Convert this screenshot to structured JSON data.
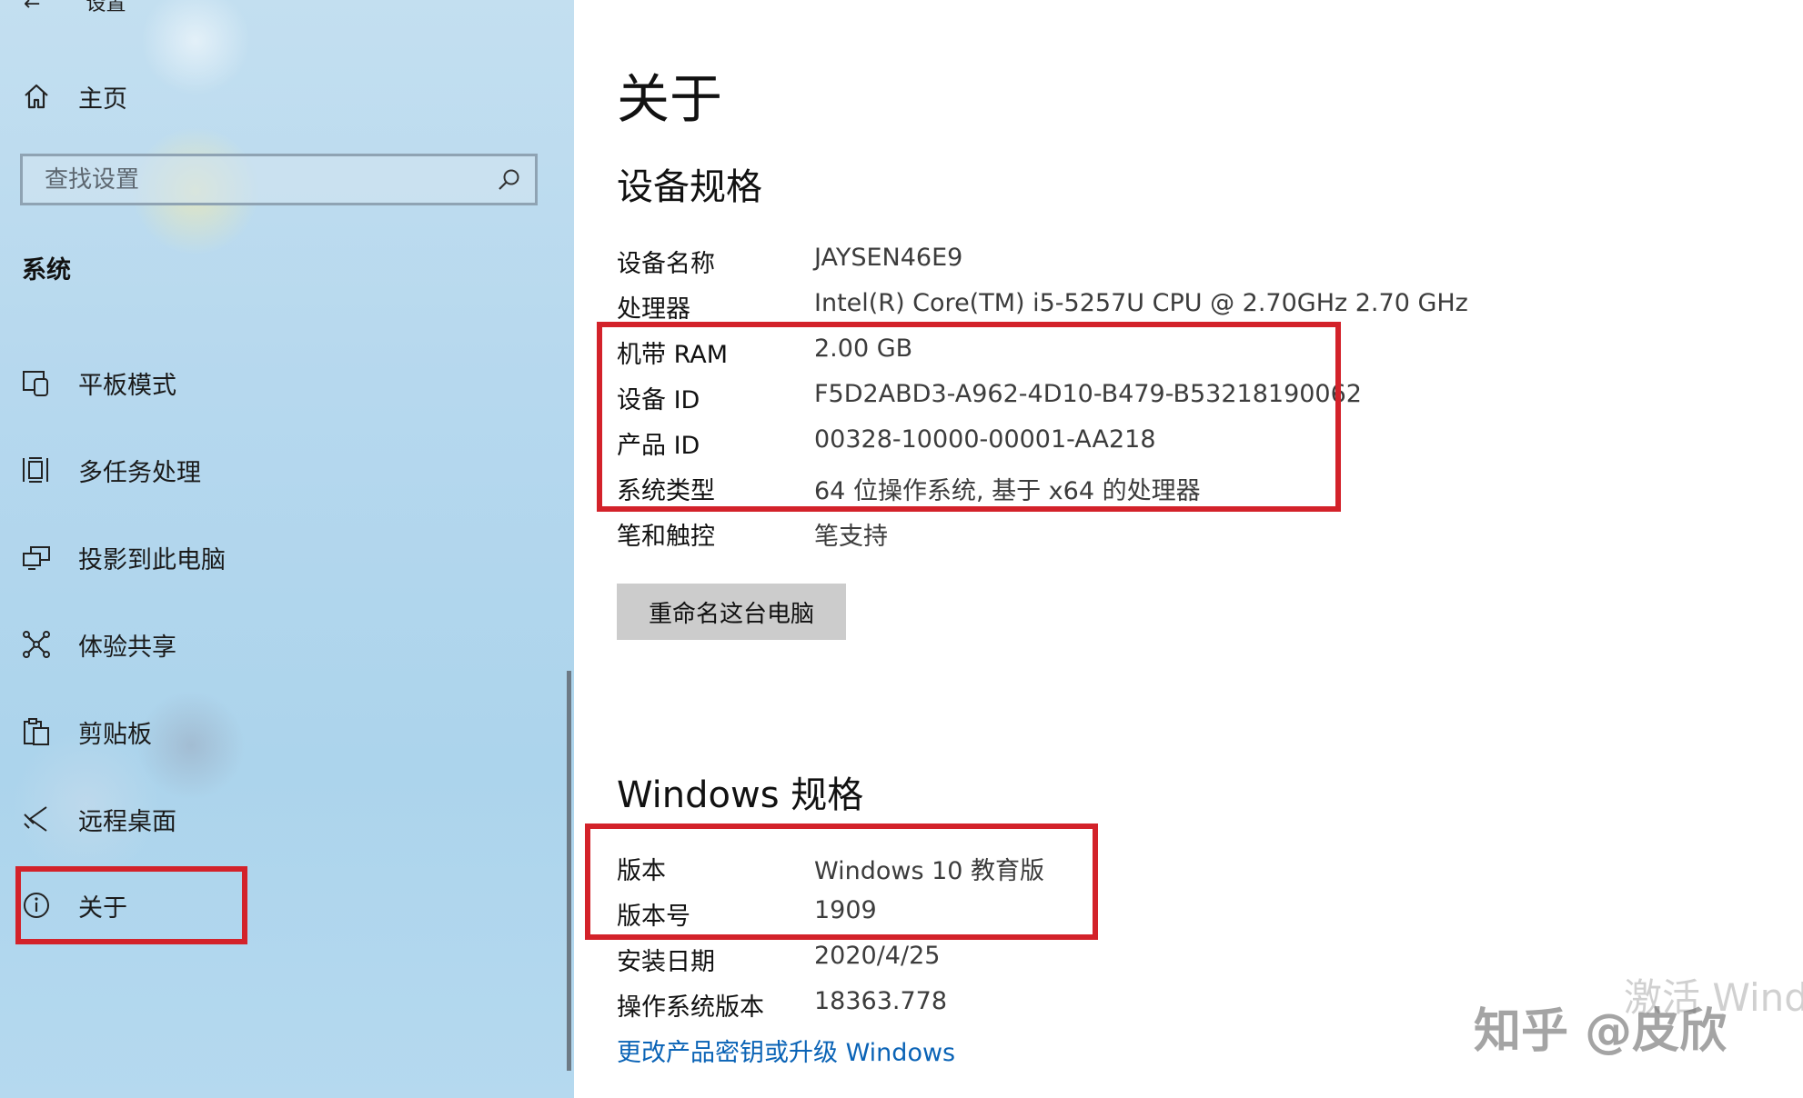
{
  "sidebar": {
    "back_title": "设置",
    "home_label": "主页",
    "search_placeholder": "查找设置",
    "section_title": "系统",
    "items": [
      {
        "label": "平板模式",
        "icon": "tablet-mode-icon"
      },
      {
        "label": "多任务处理",
        "icon": "multitasking-icon"
      },
      {
        "label": "投影到此电脑",
        "icon": "project-icon"
      },
      {
        "label": "体验共享",
        "icon": "shared-experiences-icon"
      },
      {
        "label": "剪贴板",
        "icon": "clipboard-icon"
      },
      {
        "label": "远程桌面",
        "icon": "remote-desktop-icon"
      },
      {
        "label": "关于",
        "icon": "info-icon",
        "selected": true
      }
    ]
  },
  "main": {
    "title": "关于",
    "device_spec": {
      "heading": "设备规格",
      "rows": [
        {
          "key": "设备名称",
          "value": "JAYSEN46E9"
        },
        {
          "key": "处理器",
          "value": "Intel(R) Core(TM) i5-5257U CPU @ 2.70GHz   2.70 GHz"
        },
        {
          "key": "机带 RAM",
          "value": "2.00 GB"
        },
        {
          "key": "设备 ID",
          "value": "F5D2ABD3-A962-4D10-B479-B53218190062"
        },
        {
          "key": "产品 ID",
          "value": "00328-10000-00001-AA218"
        },
        {
          "key": "系统类型",
          "value": "64 位操作系统, 基于 x64 的处理器"
        },
        {
          "key": "笔和触控",
          "value": "笔支持"
        }
      ],
      "rename_button": "重命名这台电脑"
    },
    "windows_spec": {
      "heading": "Windows 规格",
      "rows": [
        {
          "key": "版本",
          "value": "Windows 10 教育版"
        },
        {
          "key": "版本号",
          "value": "1909"
        },
        {
          "key": "安装日期",
          "value": "2020/4/25"
        },
        {
          "key": "操作系统版本",
          "value": "18363.778"
        }
      ],
      "upgrade_link": "更改产品密钥或升级 Windows"
    }
  },
  "overlay": {
    "activation_watermark": "激活 Wind",
    "site_watermark": "知乎 @皮欣"
  },
  "colors": {
    "highlight": "#d3222a",
    "link": "#0a63b6",
    "sidebar_bg": "#b6d8ee",
    "button_bg": "#cccccc"
  }
}
